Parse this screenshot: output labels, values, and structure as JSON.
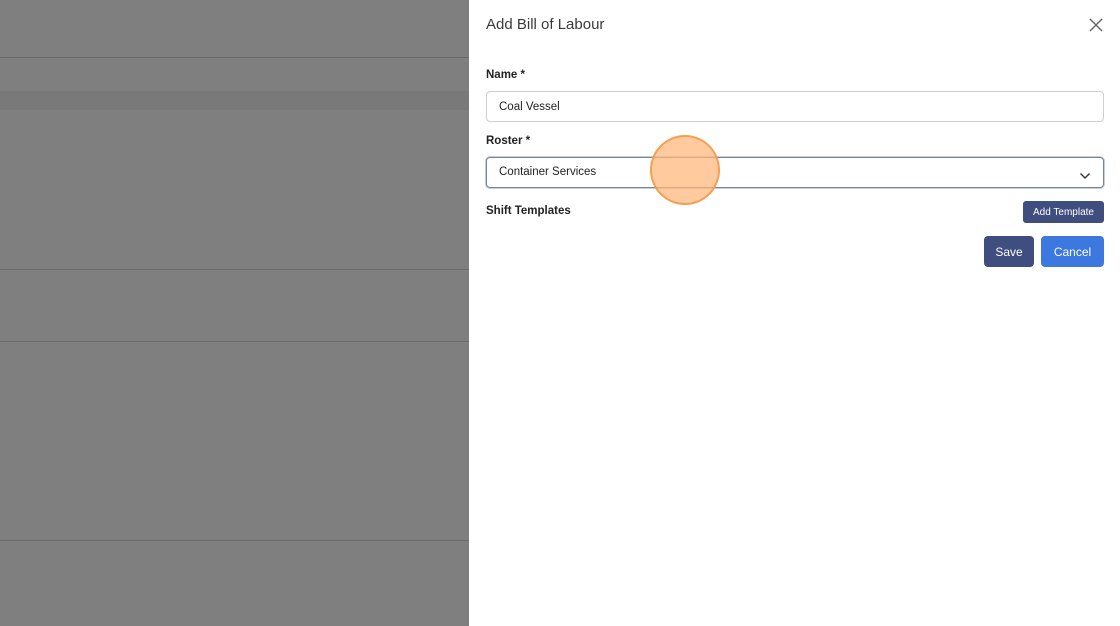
{
  "drawer": {
    "title": "Add Bill of Labour",
    "close_icon": "close-icon"
  },
  "form": {
    "name": {
      "label": "Name *",
      "value": "Coal Vessel"
    },
    "roster": {
      "label": "Roster *",
      "selected": "Container Services",
      "icon": "chevron-down-icon"
    },
    "shift_templates": {
      "label": "Shift Templates",
      "add_button": "Add Template"
    }
  },
  "actions": {
    "save": "Save",
    "cancel": "Cancel"
  },
  "colors": {
    "primary_dark": "#3f4d7f",
    "primary_blue": "#3c78e0",
    "overlay": "rgba(0,0,0,0.5)",
    "click_indicator": "#ffb778"
  }
}
